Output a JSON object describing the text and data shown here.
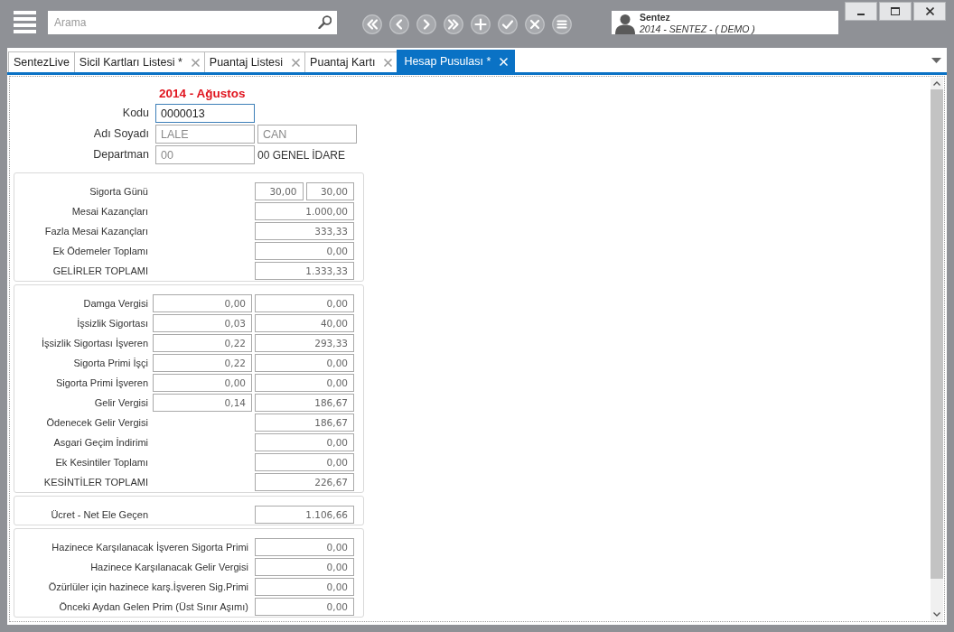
{
  "window": {
    "search": {
      "placeholder": "Arama"
    },
    "user": {
      "name": "Sentez",
      "company": "2014 - SENTEZ - ( DEMO )"
    }
  },
  "tabs": [
    {
      "label": "SentezLive",
      "selected": false,
      "closable": false
    },
    {
      "label": "Sicil Kartları Listesi *",
      "selected": false,
      "closable": true
    },
    {
      "label": "Puantaj Listesi",
      "selected": false,
      "closable": true
    },
    {
      "label": "Puantaj Kartı",
      "selected": false,
      "closable": true
    },
    {
      "label": "Hesap Pusulası *",
      "selected": true,
      "closable": true
    }
  ],
  "form": {
    "period": "2014 - Ağustos",
    "header_fields": [
      {
        "label": "Kodu",
        "values": [
          "0000013"
        ],
        "focused": true
      },
      {
        "label": "Adı Soyadı",
        "values": [
          "LALE",
          "CAN"
        ],
        "focused": false
      },
      {
        "label": "Departman",
        "values": [
          "00"
        ],
        "focused": false,
        "note": "00 GENEL İDARE"
      }
    ],
    "sections": [
      {
        "rows": [
          {
            "kind": "split",
            "label": "Sigorta Günü",
            "values": [
              "30,00",
              "30,00"
            ]
          },
          {
            "kind": "single",
            "label": "Mesai Kazançları",
            "values": [
              "1.000,00"
            ]
          },
          {
            "kind": "single",
            "label": "Fazla Mesai Kazançları",
            "values": [
              "333,33"
            ]
          },
          {
            "kind": "single",
            "label": "Ek Ödemeler Toplamı",
            "values": [
              "0,00"
            ]
          },
          {
            "kind": "single",
            "label": "GELİRLER TOPLAMI",
            "values": [
              "1.333,33"
            ]
          }
        ]
      },
      {
        "rows": [
          {
            "kind": "pair",
            "label": "Damga Vergisi",
            "values": [
              "0,00",
              "0,00"
            ]
          },
          {
            "kind": "pair",
            "label": "İşsizlik Sigortası",
            "values": [
              "0,03",
              "40,00"
            ]
          },
          {
            "kind": "pair",
            "label": "İşsizlik Sigortası İşveren",
            "values": [
              "0,22",
              "293,33"
            ]
          },
          {
            "kind": "pair",
            "label": "Sigorta Primi İşçi",
            "values": [
              "0,22",
              "0,00"
            ]
          },
          {
            "kind": "pair",
            "label": "Sigorta Primi İşveren",
            "values": [
              "0,00",
              "0,00"
            ]
          },
          {
            "kind": "pair",
            "label": "Gelir Vergisi",
            "values": [
              "0,14",
              "186,67"
            ]
          },
          {
            "kind": "single",
            "label": "Ödenecek Gelir Vergisi",
            "values": [
              "186,67"
            ]
          },
          {
            "kind": "single",
            "label": "Asgari Geçim İndirimi",
            "values": [
              "0,00"
            ]
          },
          {
            "kind": "single",
            "label": "Ek Kesintiler Toplamı",
            "values": [
              "0,00"
            ]
          },
          {
            "kind": "single",
            "label": "KESİNTİLER TOPLAMI",
            "values": [
              "226,67"
            ]
          }
        ]
      },
      {
        "rows": [
          {
            "kind": "single",
            "label": "Ücret - Net Ele Geçen",
            "values": [
              "1.106,66"
            ]
          }
        ]
      },
      {
        "rows": [
          {
            "kind": "wide",
            "label": "Hazinece Karşılanacak İşveren Sigorta Primi",
            "values": [
              "0,00"
            ]
          },
          {
            "kind": "wide",
            "label": "Hazinece Karşılanacak Gelir Vergisi",
            "values": [
              "0,00"
            ]
          },
          {
            "kind": "wide",
            "label": "Özürlüler için hazinece karş.İşveren Sig.Primi",
            "values": [
              "0,00"
            ]
          },
          {
            "kind": "wide",
            "label": "Önceki Aydan Gelen Prim (Üst Sınır Aşımı)",
            "values": [
              "0,00"
            ]
          }
        ]
      }
    ]
  }
}
